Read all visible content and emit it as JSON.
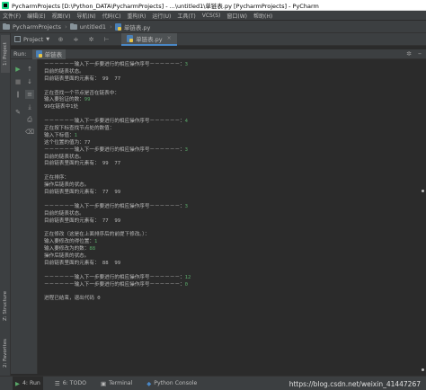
{
  "window": {
    "title": "PycharmProjects [D:\\Python_DATA\\PycharmProjects] - ...\\untitled1\\单链表.py [PycharmProjects] - PyCharm"
  },
  "menu": [
    "文件(F)",
    "编辑(E)",
    "视图(V)",
    "导航(N)",
    "代码(C)",
    "重构(R)",
    "运行(U)",
    "工具(T)",
    "VCS(S)",
    "窗口(W)",
    "帮助(H)"
  ],
  "breadcrumbs": [
    "PycharmProjects",
    "untitled1",
    "单链表.py"
  ],
  "project_bar": {
    "project_label": "Project",
    "editor_tab": "单链表.py"
  },
  "left_tabs": {
    "project": "1: Project",
    "structure": "Z: Structure",
    "favorites": "2: Favorites"
  },
  "run_panel": {
    "label": "Run:",
    "tab": "单链表"
  },
  "console_lines": [
    {
      "text": "－－－－－－输入下一步要进行的相应操作序号－－－－－－：",
      "input": "3"
    },
    {
      "text": "目前的链表状态。",
      "input": ""
    },
    {
      "text": "目前链表里面的元素有： 99  77",
      "input": ""
    },
    {
      "text": "",
      "input": ""
    },
    {
      "text": "正在查找一个节点是否在链表中：",
      "input": ""
    },
    {
      "text": "输入要验证的数：",
      "input": "99"
    },
    {
      "text": "99在链表中1处",
      "input": ""
    },
    {
      "text": "",
      "input": ""
    },
    {
      "text": "－－－－－－输入下一步要进行的相应操作序号－－－－－－：",
      "input": "4"
    },
    {
      "text": "正在按下标查找节点处的数值：",
      "input": ""
    },
    {
      "text": "输入下标值：",
      "input": "1"
    },
    {
      "text": "这个位置的值为：77",
      "input": ""
    },
    {
      "text": "－－－－－－输入下一步要进行的相应操作序号－－－－－－：",
      "input": "3"
    },
    {
      "text": "目前的链表状态。",
      "input": ""
    },
    {
      "text": "目前链表里面的元素有： 99  77",
      "input": ""
    },
    {
      "text": "",
      "input": ""
    },
    {
      "text": "正在排序：",
      "input": ""
    },
    {
      "text": "操作后链表的状态。",
      "input": ""
    },
    {
      "text": "目前链表里面的元素有： 77  99",
      "input": ""
    },
    {
      "text": "",
      "input": ""
    },
    {
      "text": "－－－－－－输入下一步要进行的相应操作序号－－－－－－：",
      "input": "3"
    },
    {
      "text": "目前的链表状态。",
      "input": ""
    },
    {
      "text": "目前链表里面的元素有： 77  99",
      "input": ""
    },
    {
      "text": "",
      "input": ""
    },
    {
      "text": "正在修改（这是在上面排序后的前提下修改。）：",
      "input": ""
    },
    {
      "text": "输入要修改的得位置：",
      "input": "1"
    },
    {
      "text": "输入要修改为的数：",
      "input": "88"
    },
    {
      "text": "操作后链表的状态。",
      "input": ""
    },
    {
      "text": "目前链表里面的元素有： 88  99",
      "input": ""
    },
    {
      "text": "",
      "input": ""
    },
    {
      "text": "－－－－－－输入下一步要进行的相应操作序号－－－－－－：",
      "input": "12"
    },
    {
      "text": "－－－－－－输入下一步要进行的相应操作序号－－－－－－：",
      "input": "0"
    },
    {
      "text": "",
      "input": ""
    },
    {
      "text": "进程已结束，退出代码 0",
      "input": ""
    }
  ],
  "bottom_tabs": [
    {
      "label": "4: Run",
      "glyph": "▶"
    },
    {
      "label": "6: TODO",
      "glyph": "☰"
    },
    {
      "label": "Terminal",
      "glyph": "▣"
    },
    {
      "label": "Python Console",
      "glyph": "◆"
    }
  ],
  "watermark": "https://blog.csdn.net/weixin_41447267",
  "colors": {
    "background": "#2b2b2b",
    "panel": "#3c3f41",
    "console_text": "#bbbbbb",
    "user_input": "#59a869"
  }
}
